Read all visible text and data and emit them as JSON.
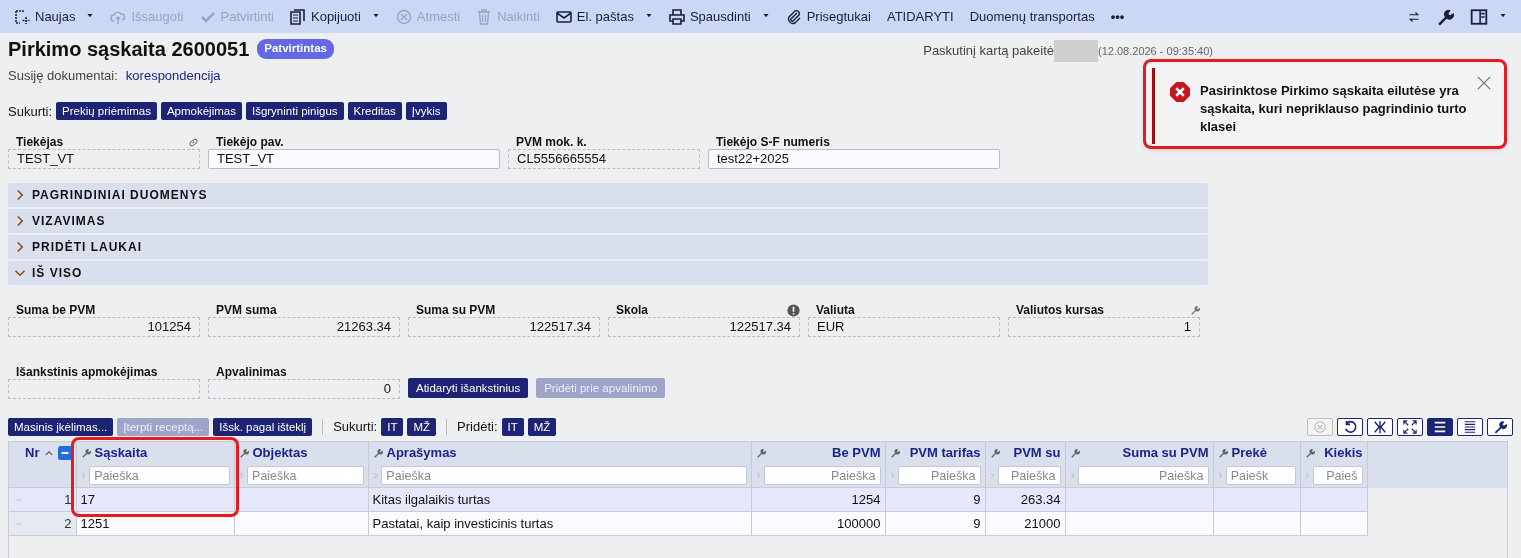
{
  "toolbar": {
    "items": [
      {
        "label": "Naujas",
        "disabled": false,
        "dropdown": true
      },
      {
        "label": "Išsaugoti",
        "disabled": true,
        "dropdown": false
      },
      {
        "label": "Patvirtinti",
        "disabled": true,
        "dropdown": false
      },
      {
        "label": "Kopijuoti",
        "disabled": false,
        "dropdown": true
      },
      {
        "label": "Atmesti",
        "disabled": true,
        "dropdown": false
      },
      {
        "label": "Naikinti",
        "disabled": true,
        "dropdown": false
      },
      {
        "label": "El. paštas",
        "disabled": false,
        "dropdown": true
      },
      {
        "label": "Spausdinti",
        "disabled": false,
        "dropdown": true
      },
      {
        "label": "Prisegtukai",
        "disabled": false,
        "dropdown": false
      },
      {
        "label": "ATIDARYTI",
        "disabled": false,
        "dropdown": false
      },
      {
        "label": "Duomenų transportas",
        "disabled": false,
        "dropdown": false
      }
    ],
    "more": "•••"
  },
  "document": {
    "title": "Pirkimo sąskaita 2600051",
    "status": "Patvirtintas",
    "related_label": "Susiję dokumentai:",
    "related_link": "korespondencija",
    "last_changed_label": "Paskutinį kartą pakeitė",
    "author_redacted": true,
    "last_changed_time": "(12.08.2026 - 09:35:40)"
  },
  "create": {
    "label": "Sukurti:",
    "buttons": [
      "Prekių priėmimas",
      "Apmokėjimas",
      "Išgryninti pinigus",
      "Kreditas",
      "Įvykis"
    ]
  },
  "fields": [
    {
      "label": "Tiekėjas",
      "value": "TEST_VT",
      "editable": false
    },
    {
      "label": "Tiekėjo pav.",
      "value": "TEST_VT",
      "editable": true
    },
    {
      "label": "PVM mok. k.",
      "value": "CL5556665554",
      "editable": false
    },
    {
      "label": "Tiekėjo S-F numeris",
      "value": "test22+2025",
      "editable": true
    }
  ],
  "sections": [
    {
      "title": "PAGRINDINIAI DUOMENYS",
      "expanded": false
    },
    {
      "title": "VIZAVIMAS",
      "expanded": false
    },
    {
      "title": "PRIDĖTI LAUKAI",
      "expanded": false
    },
    {
      "title": "IŠ VISO",
      "expanded": true
    }
  ],
  "totals": [
    {
      "label": "Suma be PVM",
      "value": "101254",
      "kind": "number"
    },
    {
      "label": "PVM suma",
      "value": "21263.34",
      "kind": "number"
    },
    {
      "label": "Suma su PVM",
      "value": "122517.34",
      "kind": "number"
    },
    {
      "label": "Skola",
      "value": "122517.34",
      "kind": "number"
    },
    {
      "label": "Valiuta",
      "value": "EUR",
      "kind": "text"
    },
    {
      "label": "Valiutos kursas",
      "value": "1",
      "kind": "number"
    },
    {
      "label": "Išankstinis apmokėjimas",
      "kind": "text"
    },
    {
      "label": "Apvalinimas",
      "value": "0",
      "kind": "number"
    }
  ],
  "totals_buttons": [
    {
      "label": "Atidaryti išankstinius",
      "disabled": false
    },
    {
      "label": "Pridėti prie apvalinimo",
      "disabled": true
    }
  ],
  "table_toolbar": {
    "buttons": [
      {
        "label": "Masinis įkėlimas...",
        "disabled": false
      },
      {
        "label": "Įterpti receptą...",
        "disabled": true
      },
      {
        "label": "Išsk. pagal išteklį",
        "disabled": false
      }
    ],
    "create_label": "Sukurti:",
    "create_buttons": [
      "IT",
      "MŽ"
    ],
    "add_label": "Pridėti:",
    "add_buttons": [
      "IT",
      "MŽ"
    ],
    "view_buttons": [
      {
        "disabled": true,
        "selected": false
      },
      {
        "disabled": false,
        "selected": false
      },
      {
        "disabled": false,
        "selected": false
      },
      {
        "disabled": false,
        "selected": false
      },
      {
        "disabled": false,
        "selected": true
      },
      {
        "disabled": false,
        "selected": false
      },
      {
        "disabled": false,
        "selected": false
      }
    ]
  },
  "table": {
    "nr_label": "Nr",
    "columns": [
      {
        "label": "Sąskaita",
        "kind": "text",
        "placeholder": "Paieška",
        "highlighted": true
      },
      {
        "label": "Objektas",
        "kind": "text",
        "placeholder": "Paieška",
        "highlighted": false
      },
      {
        "label": "Aprašymas",
        "kind": "text",
        "placeholder": "Paieška",
        "highlighted": false
      },
      {
        "label": "Be PVM",
        "kind": "number",
        "placeholder": "Paieška",
        "highlighted": false
      },
      {
        "label": "PVM tarifas",
        "kind": "number",
        "placeholder": "Paieška",
        "highlighted": false
      },
      {
        "label": "PVM su",
        "kind": "number",
        "placeholder": "Paieška",
        "highlighted": false
      },
      {
        "label": "Suma su PVM",
        "kind": "number",
        "placeholder": "Paieška",
        "highlighted": false
      },
      {
        "label": "Prekė",
        "kind": "text",
        "placeholder": "Paiešk",
        "highlighted": false
      },
      {
        "label": "Kiekis",
        "kind": "number",
        "placeholder": "Paieš",
        "highlighted": false
      }
    ],
    "rows": [
      {
        "nr": "1",
        "selected": true,
        "cells": [
          "17",
          "",
          "Kitas ilgalaikis turtas",
          "1254",
          "9",
          "263.34",
          "",
          "",
          ""
        ]
      },
      {
        "nr": "2",
        "selected": false,
        "cells": [
          "1251",
          "",
          "Pastatai, kaip investicinis turtas",
          "100000",
          "9",
          "21000",
          "",
          "",
          ""
        ]
      }
    ]
  },
  "toast": {
    "message": "Pasirinktose Pirkimo sąskaita eilutėse yra sąskaita, kuri nepriklauso pagrindinio turto klasei",
    "highlighted": true
  }
}
